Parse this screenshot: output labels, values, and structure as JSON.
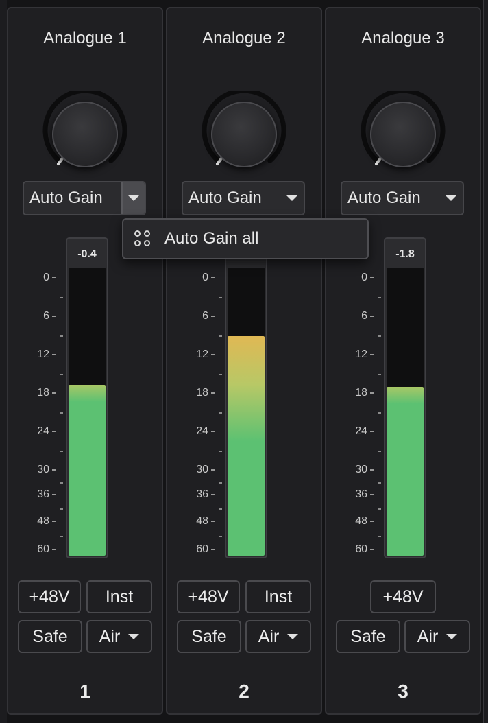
{
  "channels": [
    {
      "name": "Analogue 1",
      "number": "1",
      "knob_level": 0.0,
      "auto_gain_label": "Auto Gain",
      "dropdown_active": true,
      "peak": "-0.4",
      "meter_level_db": 16.9,
      "buttons": {
        "phantom": "+48V",
        "inst": "Inst",
        "safe": "Safe",
        "air": "Air"
      },
      "has_inst": true
    },
    {
      "name": "Analogue 2",
      "number": "2",
      "knob_level": 0.0,
      "auto_gain_label": "Auto Gain",
      "dropdown_active": false,
      "peak": "",
      "meter_level_db": 9.3,
      "buttons": {
        "phantom": "+48V",
        "inst": "Inst",
        "safe": "Safe",
        "air": "Air"
      },
      "has_inst": true
    },
    {
      "name": "Analogue 3",
      "number": "3",
      "knob_level": 0.0,
      "auto_gain_label": "Auto Gain",
      "dropdown_active": false,
      "peak": "-1.8",
      "meter_level_db": 17.2,
      "buttons": {
        "phantom": "+48V",
        "safe": "Safe",
        "air": "Air"
      },
      "has_inst": false
    }
  ],
  "scale_labels": [
    "0",
    "6",
    "12",
    "18",
    "24",
    "30",
    "36",
    "48",
    "60"
  ],
  "popup": {
    "label": "Auto Gain all",
    "icon": "grid-dots-icon"
  },
  "colors": {
    "meter_green": "#5cc172",
    "meter_yellow": "#e0b854",
    "panel_bg": "#1f1f22",
    "accent_text": "#e8e8e8"
  }
}
